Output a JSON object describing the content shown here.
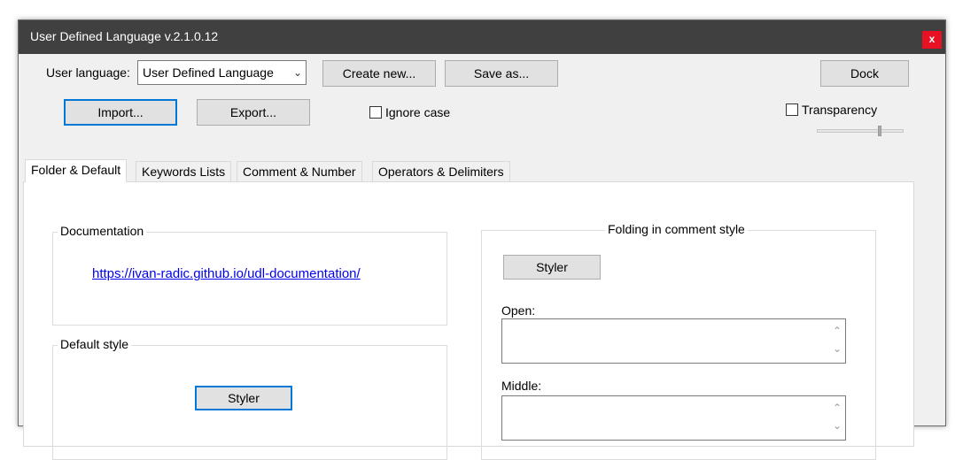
{
  "window": {
    "title": "User Defined Language v.2.1.0.12",
    "close_label": "x"
  },
  "toolbar": {
    "user_language_label": "User language:",
    "user_language_value": "User Defined Language",
    "create_new_label": "Create new...",
    "save_as_label": "Save as...",
    "dock_label": "Dock",
    "import_label": "Import...",
    "export_label": "Export...",
    "ignore_case_label": "Ignore case",
    "transparency_label": "Transparency",
    "ignore_case_checked": false,
    "transparency_checked": false,
    "transparency_level": 0.72
  },
  "tabs": [
    {
      "label": "Folder & Default",
      "active": true
    },
    {
      "label": "Keywords Lists",
      "active": false
    },
    {
      "label": "Comment & Number",
      "active": false
    },
    {
      "label": "Operators & Delimiters",
      "active": false
    }
  ],
  "documentation": {
    "legend": "Documentation",
    "link": "https://ivan-radic.github.io/udl-documentation/"
  },
  "default_style": {
    "legend": "Default style",
    "styler_label": "Styler"
  },
  "folding": {
    "legend": "Folding in comment style",
    "styler_label": "Styler",
    "open_label": "Open:",
    "middle_label": "Middle:",
    "open_value": "",
    "middle_value": ""
  },
  "colors": {
    "titlebar": "#404040",
    "close_button": "#e81123",
    "focus_border": "#0078d7",
    "link": "#0000ee"
  }
}
